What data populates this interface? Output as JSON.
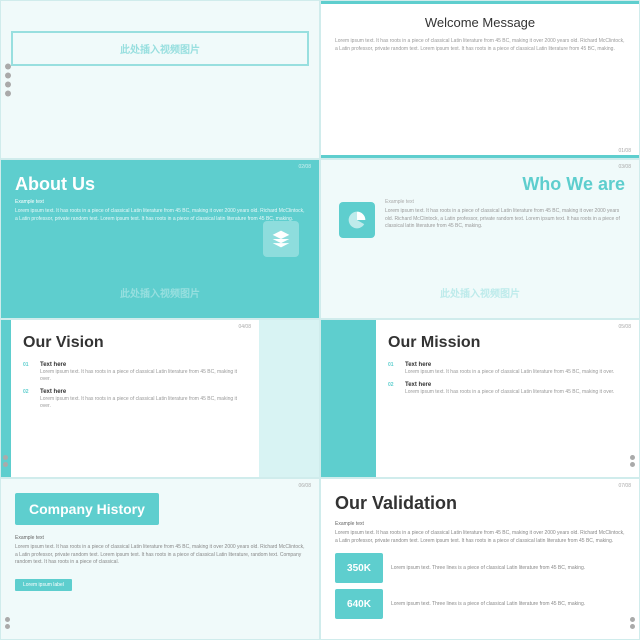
{
  "slides": {
    "slide1": {
      "watermark": "此处插入视频图片",
      "bg_color": "#f0fafa"
    },
    "slide2": {
      "title": "Welcome Message",
      "body": "Lorem ipsum text. It has roots in a piece of classical Latin literature from 45 BC, making it over 2000 years old. Richard McClintock, a Latin professor, private random text. Lorem ipsum text. It has roots in a piece of classical Latin literature from 45 BC, making.",
      "slide_num": "01/08"
    },
    "slide3": {
      "title": "About Us",
      "example_label": "Example text",
      "body": "Lorem ipsum text. It has roots in a piece of classical Latin literature from 45 BC, making it over 2000 years old. Richard McClintock, a Latin professor, private random text. Lorem ipsum text. It has roots in a piece of classical latin literature from 45 BC, making.",
      "watermark": "此处插入视频图片",
      "slide_num": "02/08"
    },
    "slide4": {
      "title": "Who We are",
      "example_label": "Example text",
      "body": "Lorem ipsum text. It has roots in a piece of classical Latin literature from 45 BC, making it over 2000 years old. Richard McClintock, a Latin professor, private random text. Lorem ipsum text. It has roots in a piece of classical latin literature from 45 BC, making.",
      "watermark": "此处插入视频图片",
      "slide_num": "03/08"
    },
    "slide5": {
      "title": "Our Vision",
      "slide_num": "04/08",
      "items": [
        {
          "num": "01",
          "title": "Text here",
          "text": "Lorem ipsum text. It has roots in a piece of classical Latin literature from 45 BC, making it over."
        },
        {
          "num": "02",
          "title": "Text here",
          "text": "Lorem ipsum text. It has roots in a piece of classical Latin literature from 45 BC, making it over."
        }
      ]
    },
    "slide6": {
      "title": "Our Mission",
      "slide_num": "05/08",
      "items": [
        {
          "num": "01",
          "title": "Text here",
          "text": "Lorem ipsum text. It has roots in a piece of classical Latin literature from 45 BC, making it over."
        },
        {
          "num": "02",
          "title": "Text here",
          "text": "Lorem ipsum text. It has roots in a piece of classical Latin literature from 45 BC, making it over."
        }
      ]
    },
    "slide7": {
      "title": "Company History",
      "example_label": "Example text",
      "body": "Lorem ipsum text. It has roots in a piece of classical Latin literature from 45 BC, making it over 2000 years old. Richard McClintock, a Latin professor, private random text. Lorem ipsum text. It has roots in a piece of classical Latin literature, random text. Company random text. It has roots in a piece of classical.",
      "button_label": "Lorem ipsum label",
      "slide_num": "06/08"
    },
    "slide8": {
      "title": "Our Validation",
      "example_label": "Example text",
      "body": "Lorem ipsum text. It has roots in a piece of classical Latin literature from 45 BC, making it over 2000 years old. Richard McClintock, a Latin professor, private random text. Lorem ipsum text. It has roots in a piece of classical latin literature from 45 BC, making.",
      "slide_num": "07/08",
      "stats": [
        {
          "value": "350K",
          "text": "Lorem ipsum text. Three lines is a piece of classical Latin literature from 45 BC, making."
        },
        {
          "value": "640K",
          "text": "Lorem ipsum text. Three lines is a piece of classical Latin literature from 45 BC, making."
        }
      ]
    }
  }
}
